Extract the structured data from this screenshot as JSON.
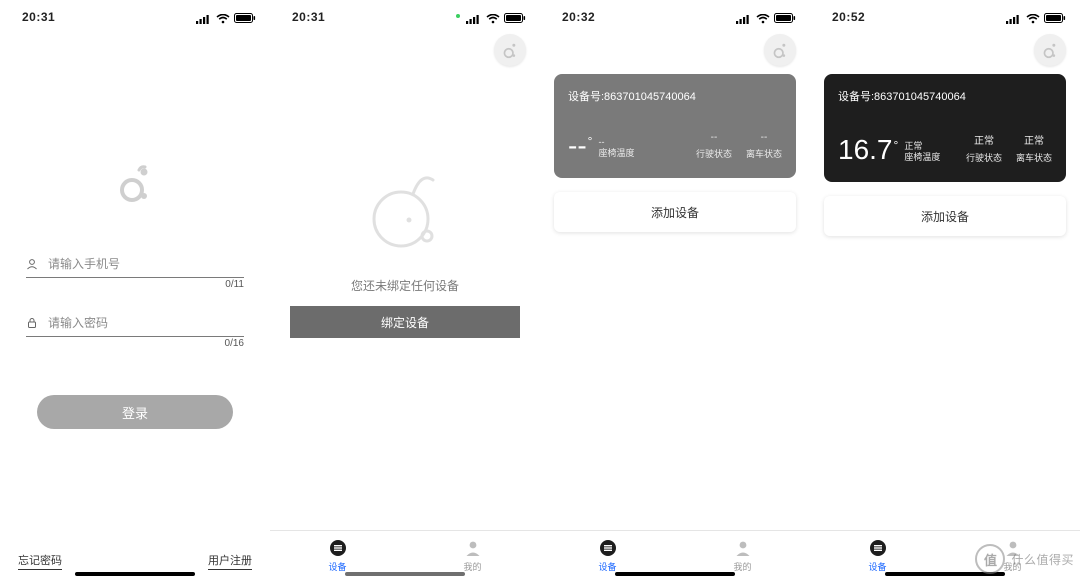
{
  "statusbar": {
    "times": [
      "20:31",
      "20:31",
      "20:32",
      "20:52"
    ]
  },
  "login": {
    "phone_placeholder": "请输入手机号",
    "phone_counter": "0/11",
    "password_placeholder": "请输入密码",
    "password_counter": "0/16",
    "login_button": "登录",
    "forgot_password": "忘记密码",
    "register": "用户注册"
  },
  "empty": {
    "message": "您还未绑定任何设备",
    "bind_button": "绑定设备"
  },
  "card_grey": {
    "device_label": "设备号:863701045740064",
    "temp_value": "--",
    "temp_status": "--",
    "temp_label": "座椅温度",
    "drive_value": "--",
    "drive_label": "行驶状态",
    "leave_value": "--",
    "leave_label": "离车状态"
  },
  "card_dark": {
    "device_label": "设备号:863701045740064",
    "temp_value": "16.7",
    "temp_status": "正常",
    "temp_label": "座椅温度",
    "drive_value": "正常",
    "drive_label": "行驶状态",
    "leave_value": "正常",
    "leave_label": "离车状态"
  },
  "add_device_button": "添加设备",
  "tabs": {
    "devices": "设备",
    "mine": "我的"
  },
  "watermark": {
    "glyph": "值",
    "text": "什么值得买"
  }
}
